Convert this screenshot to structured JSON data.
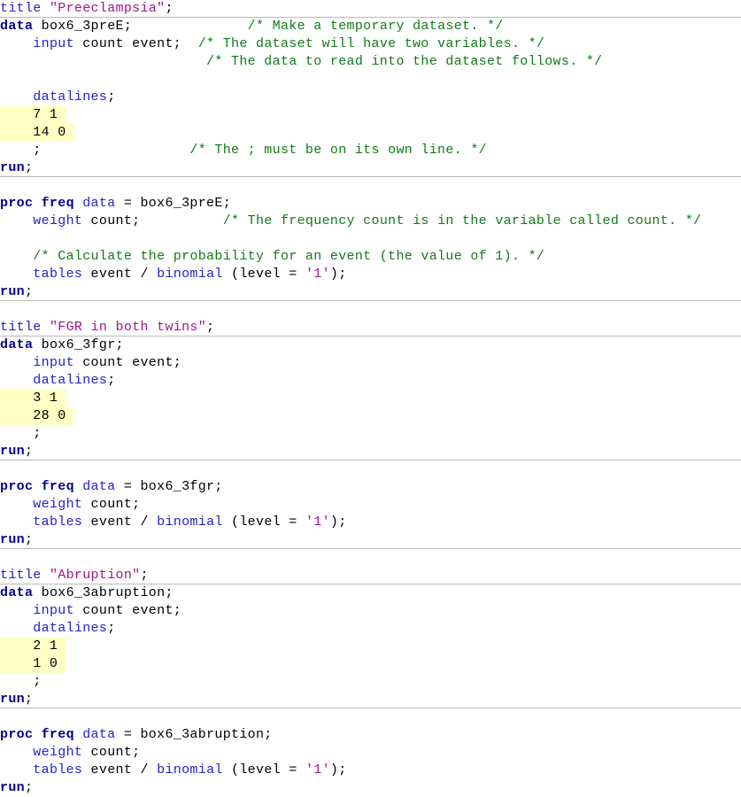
{
  "document": {
    "kind": "sas-program-listing",
    "language": "SAS",
    "colors": {
      "background": "#ffffff",
      "keyword": "#00008b",
      "statement": "#2222cc",
      "plain": "#000000",
      "comment": "#117a17",
      "string": "#a0158c",
      "highlight": "#ffffc4",
      "rule": "#b9b9b9"
    }
  },
  "blocks": [
    {
      "id": "block-preeclampsia-data",
      "title": "Preeclampsia",
      "dataset": "box6_3preE",
      "lines": [
        {
          "id": "l1",
          "rule": true,
          "tokens": [
            {
              "t": "title ",
              "c": "stmt"
            },
            {
              "t": "\"Preeclampsia\"",
              "c": "string"
            },
            {
              "t": ";",
              "c": "plain"
            }
          ]
        },
        {
          "id": "l2",
          "tokens": [
            {
              "t": "data",
              "c": "kw"
            },
            {
              "t": " box6_3preE;",
              "c": "plain"
            },
            {
              "t": "              ",
              "c": "plain"
            },
            {
              "t": "/* Make a temporary dataset. */",
              "c": "comment"
            }
          ]
        },
        {
          "id": "l3",
          "tokens": [
            {
              "t": "    ",
              "c": "plain"
            },
            {
              "t": "input",
              "c": "stmt"
            },
            {
              "t": " count event;",
              "c": "plain"
            },
            {
              "t": "  ",
              "c": "plain"
            },
            {
              "t": "/* The dataset will have two variables. */",
              "c": "comment"
            }
          ]
        },
        {
          "id": "l4",
          "tokens": [
            {
              "t": "                         ",
              "c": "plain"
            },
            {
              "t": "/* The data to read into the dataset follows. */",
              "c": "comment"
            }
          ]
        },
        {
          "id": "l5",
          "blank": true,
          "tokens": []
        },
        {
          "id": "l6",
          "tokens": [
            {
              "t": "    ",
              "c": "plain"
            },
            {
              "t": "datalines",
              "c": "stmt"
            },
            {
              "t": ";",
              "c": "plain"
            }
          ]
        },
        {
          "id": "l7",
          "highlight": true,
          "tokens": [
            {
              "t": "    7 1 ",
              "c": "plain"
            }
          ]
        },
        {
          "id": "l8",
          "highlight": true,
          "tokens": [
            {
              "t": "    14 0 ",
              "c": "plain"
            }
          ]
        },
        {
          "id": "l9",
          "tokens": [
            {
              "t": "    ;",
              "c": "plain"
            },
            {
              "t": "                  ",
              "c": "plain"
            },
            {
              "t": "/* The ; must be on its own line. */",
              "c": "comment"
            }
          ]
        },
        {
          "id": "l10",
          "rule": true,
          "tokens": [
            {
              "t": "run",
              "c": "kw"
            },
            {
              "t": ";",
              "c": "plain"
            }
          ]
        }
      ]
    },
    {
      "id": "block-preeclampsia-proc",
      "lines": [
        {
          "id": "l11",
          "blank": true,
          "tokens": []
        },
        {
          "id": "l12",
          "tokens": [
            {
              "t": "proc freq ",
              "c": "kw"
            },
            {
              "t": "data",
              "c": "stmt"
            },
            {
              "t": " = box6_3preE;",
              "c": "plain"
            }
          ]
        },
        {
          "id": "l13",
          "tokens": [
            {
              "t": "    ",
              "c": "plain"
            },
            {
              "t": "weight",
              "c": "stmt"
            },
            {
              "t": " count;",
              "c": "plain"
            },
            {
              "t": "          ",
              "c": "plain"
            },
            {
              "t": "/* The frequency count is in the variable called count. */",
              "c": "comment"
            }
          ]
        },
        {
          "id": "l14",
          "blank": true,
          "tokens": []
        },
        {
          "id": "l15",
          "tokens": [
            {
              "t": "    ",
              "c": "plain"
            },
            {
              "t": "/* Calculate the probability for an event (the value of 1). */",
              "c": "comment"
            }
          ]
        },
        {
          "id": "l16",
          "tokens": [
            {
              "t": "    ",
              "c": "plain"
            },
            {
              "t": "tables",
              "c": "stmt"
            },
            {
              "t": " event / ",
              "c": "plain"
            },
            {
              "t": "binomial",
              "c": "stmt"
            },
            {
              "t": " (level = ",
              "c": "plain"
            },
            {
              "t": "'1'",
              "c": "literal"
            },
            {
              "t": ");",
              "c": "plain"
            }
          ]
        },
        {
          "id": "l17",
          "rule": true,
          "tokens": [
            {
              "t": "run",
              "c": "kw"
            },
            {
              "t": ";",
              "c": "plain"
            }
          ]
        }
      ]
    },
    {
      "id": "block-fgr-data",
      "title": "FGR in both twins",
      "dataset": "box6_3fgr",
      "lines": [
        {
          "id": "l18",
          "blank": true,
          "tokens": []
        },
        {
          "id": "l19",
          "rule": true,
          "tokens": [
            {
              "t": "title ",
              "c": "stmt"
            },
            {
              "t": "\"FGR in both twins\"",
              "c": "string"
            },
            {
              "t": ";",
              "c": "plain"
            }
          ]
        },
        {
          "id": "l20",
          "tokens": [
            {
              "t": "data",
              "c": "kw"
            },
            {
              "t": " box6_3fgr;",
              "c": "plain"
            }
          ]
        },
        {
          "id": "l21",
          "tokens": [
            {
              "t": "    ",
              "c": "plain"
            },
            {
              "t": "input",
              "c": "stmt"
            },
            {
              "t": " count event;",
              "c": "plain"
            }
          ]
        },
        {
          "id": "l22",
          "tokens": [
            {
              "t": "    ",
              "c": "plain"
            },
            {
              "t": "datalines",
              "c": "stmt"
            },
            {
              "t": ";",
              "c": "plain"
            }
          ]
        },
        {
          "id": "l23",
          "highlight": true,
          "tokens": [
            {
              "t": "    3 1 ",
              "c": "plain"
            }
          ]
        },
        {
          "id": "l24",
          "highlight": true,
          "tokens": [
            {
              "t": "    28 0 ",
              "c": "plain"
            }
          ]
        },
        {
          "id": "l25",
          "tokens": [
            {
              "t": "    ;",
              "c": "plain"
            }
          ]
        },
        {
          "id": "l26",
          "rule": true,
          "tokens": [
            {
              "t": "run",
              "c": "kw"
            },
            {
              "t": ";",
              "c": "plain"
            }
          ]
        }
      ]
    },
    {
      "id": "block-fgr-proc",
      "lines": [
        {
          "id": "l27",
          "blank": true,
          "tokens": []
        },
        {
          "id": "l28",
          "tokens": [
            {
              "t": "proc freq ",
              "c": "kw"
            },
            {
              "t": "data",
              "c": "stmt"
            },
            {
              "t": " = box6_3fgr;",
              "c": "plain"
            }
          ]
        },
        {
          "id": "l29",
          "tokens": [
            {
              "t": "    ",
              "c": "plain"
            },
            {
              "t": "weight",
              "c": "stmt"
            },
            {
              "t": " count;",
              "c": "plain"
            }
          ]
        },
        {
          "id": "l30",
          "tokens": [
            {
              "t": "    ",
              "c": "plain"
            },
            {
              "t": "tables",
              "c": "stmt"
            },
            {
              "t": " event / ",
              "c": "plain"
            },
            {
              "t": "binomial",
              "c": "stmt"
            },
            {
              "t": " (level = ",
              "c": "plain"
            },
            {
              "t": "'1'",
              "c": "literal"
            },
            {
              "t": ");",
              "c": "plain"
            }
          ]
        },
        {
          "id": "l31",
          "rule": true,
          "tokens": [
            {
              "t": "run",
              "c": "kw"
            },
            {
              "t": ";",
              "c": "plain"
            }
          ]
        }
      ]
    },
    {
      "id": "block-abruption-data",
      "title": "Abruption",
      "dataset": "box6_3abruption",
      "lines": [
        {
          "id": "l32",
          "blank": true,
          "tokens": []
        },
        {
          "id": "l33",
          "rule": true,
          "tokens": [
            {
              "t": "title ",
              "c": "stmt"
            },
            {
              "t": "\"Abruption\"",
              "c": "string"
            },
            {
              "t": ";",
              "c": "plain"
            }
          ]
        },
        {
          "id": "l34",
          "tokens": [
            {
              "t": "data",
              "c": "kw"
            },
            {
              "t": " box6_3abruption;",
              "c": "plain"
            }
          ]
        },
        {
          "id": "l35",
          "tokens": [
            {
              "t": "    ",
              "c": "plain"
            },
            {
              "t": "input",
              "c": "stmt"
            },
            {
              "t": " count event;",
              "c": "plain"
            }
          ]
        },
        {
          "id": "l36",
          "tokens": [
            {
              "t": "    ",
              "c": "plain"
            },
            {
              "t": "datalines",
              "c": "stmt"
            },
            {
              "t": ";",
              "c": "plain"
            }
          ]
        },
        {
          "id": "l37",
          "highlight": true,
          "tokens": [
            {
              "t": "    2 1 ",
              "c": "plain"
            }
          ]
        },
        {
          "id": "l38",
          "highlight": true,
          "tokens": [
            {
              "t": "    1 0 ",
              "c": "plain"
            }
          ]
        },
        {
          "id": "l39",
          "tokens": [
            {
              "t": "    ;",
              "c": "plain"
            }
          ]
        },
        {
          "id": "l40",
          "rule": true,
          "tokens": [
            {
              "t": "run",
              "c": "kw"
            },
            {
              "t": ";",
              "c": "plain"
            }
          ]
        }
      ]
    },
    {
      "id": "block-abruption-proc",
      "lines": [
        {
          "id": "l41",
          "blank": true,
          "tokens": []
        },
        {
          "id": "l42",
          "tokens": [
            {
              "t": "proc freq ",
              "c": "kw"
            },
            {
              "t": "data",
              "c": "stmt"
            },
            {
              "t": " = box6_3abruption;",
              "c": "plain"
            }
          ]
        },
        {
          "id": "l43",
          "tokens": [
            {
              "t": "    ",
              "c": "plain"
            },
            {
              "t": "weight",
              "c": "stmt"
            },
            {
              "t": " count;",
              "c": "plain"
            }
          ]
        },
        {
          "id": "l44",
          "tokens": [
            {
              "t": "    ",
              "c": "plain"
            },
            {
              "t": "tables",
              "c": "stmt"
            },
            {
              "t": " event / ",
              "c": "plain"
            },
            {
              "t": "binomial",
              "c": "stmt"
            },
            {
              "t": " (level = ",
              "c": "plain"
            },
            {
              "t": "'1'",
              "c": "literal"
            },
            {
              "t": ");",
              "c": "plain"
            }
          ]
        },
        {
          "id": "l45",
          "tokens": [
            {
              "t": "run",
              "c": "kw"
            },
            {
              "t": ";",
              "c": "plain"
            }
          ]
        }
      ]
    }
  ]
}
